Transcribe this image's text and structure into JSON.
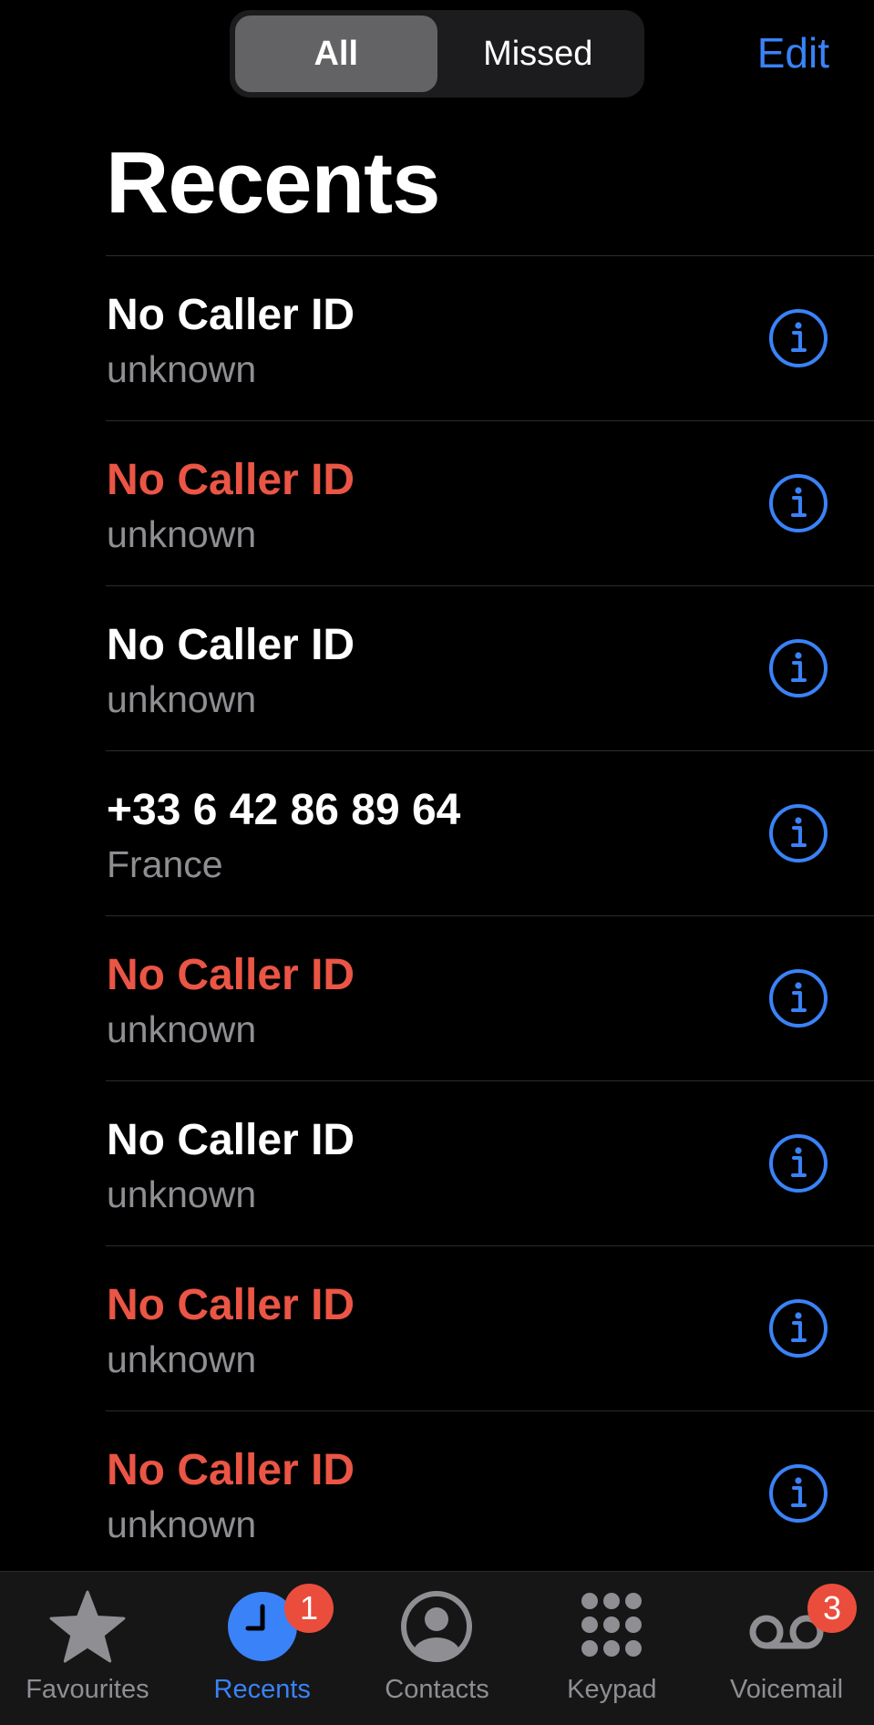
{
  "header": {
    "segments": [
      {
        "label": "All",
        "selected": true
      },
      {
        "label": "Missed",
        "selected": false
      }
    ],
    "edit_label": "Edit",
    "title": "Recents"
  },
  "calls": [
    {
      "name": "No Caller ID",
      "detail": "unknown",
      "missed": false
    },
    {
      "name": "No Caller ID",
      "detail": "unknown",
      "missed": true
    },
    {
      "name": "No Caller ID",
      "detail": "unknown",
      "missed": false
    },
    {
      "name": "+33 6 42 86 89 64",
      "detail": "France",
      "missed": false
    },
    {
      "name": "No Caller ID",
      "detail": "unknown",
      "missed": true
    },
    {
      "name": "No Caller ID",
      "detail": "unknown",
      "missed": false
    },
    {
      "name": "No Caller ID",
      "detail": "unknown",
      "missed": true
    },
    {
      "name": "No Caller ID",
      "detail": "unknown",
      "missed": true
    }
  ],
  "tabbar": {
    "tabs": [
      {
        "label": "Favourites",
        "icon": "star-icon",
        "active": false
      },
      {
        "label": "Recents",
        "icon": "clock-icon",
        "active": true,
        "badge": "1"
      },
      {
        "label": "Contacts",
        "icon": "person-circle-icon",
        "active": false
      },
      {
        "label": "Keypad",
        "icon": "keypad-icon",
        "active": false
      },
      {
        "label": "Voicemail",
        "icon": "voicemail-icon",
        "active": false,
        "badge": "3"
      }
    ]
  },
  "colors": {
    "accent": "#3a82f7",
    "missed": "#eb5545",
    "secondary_text": "#8e8e93",
    "badge": "#eb4d3d",
    "background": "#000000"
  }
}
